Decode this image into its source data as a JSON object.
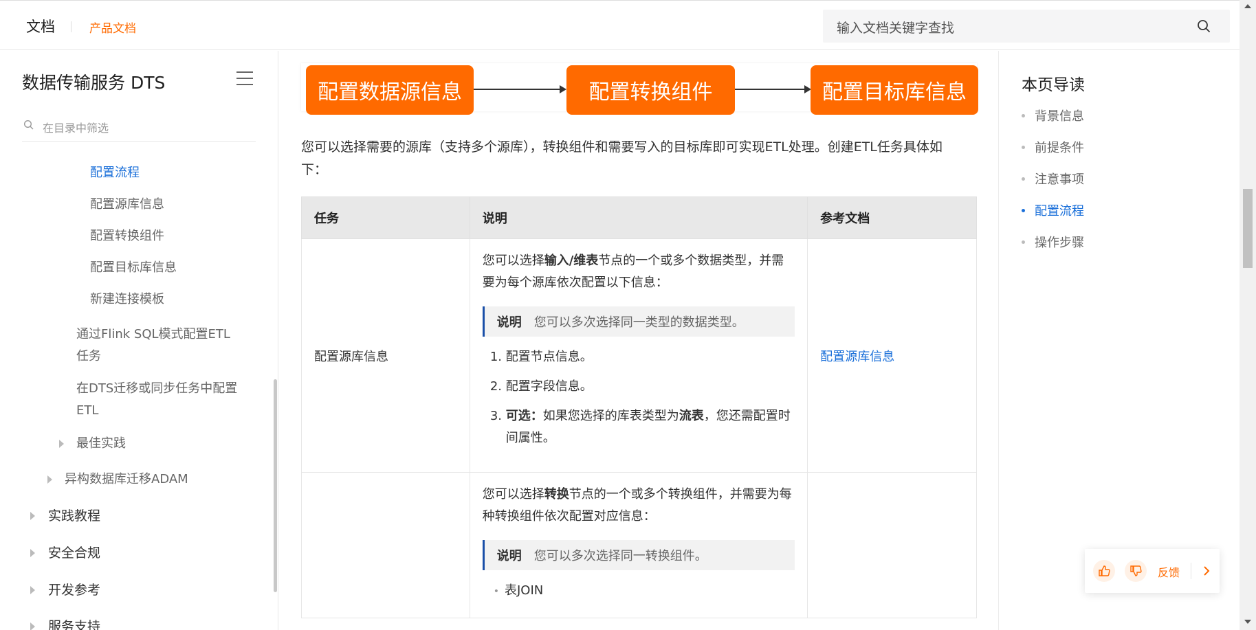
{
  "header": {
    "logo": "文档",
    "product": "产品文档",
    "search_placeholder": "输入文档关键字查找"
  },
  "sidebar": {
    "title": "数据传输服务 DTS",
    "filter_placeholder": "在目录中筛选",
    "items": [
      {
        "label": "配置流程",
        "state": "active"
      },
      {
        "label": "配置源库信息"
      },
      {
        "label": "配置转换组件"
      },
      {
        "label": "配置目标库信息"
      },
      {
        "label": "新建连接模板"
      },
      {
        "label_line1": "通过Flink SQL模式配置ETL",
        "label_line2": "任务"
      },
      {
        "label_line1": "在DTS迁移或同步任务中配置",
        "label_line2": "ETL"
      },
      {
        "label": "最佳实践"
      },
      {
        "label": "异构数据库迁移ADAM"
      },
      {
        "label": "实践教程"
      },
      {
        "label": "安全合规"
      },
      {
        "label": "开发参考"
      },
      {
        "label": "服务支持"
      }
    ]
  },
  "flow": {
    "steps": [
      "配置数据源信息",
      "配置转换组件",
      "配置目标库信息"
    ]
  },
  "intro": {
    "line1": "您可以选择需要的源库（支持多个源库），转换组件和需要写入的目标库即可实现ETL处理。创建ETL任务具体如",
    "line2": "下："
  },
  "table": {
    "headers": [
      "任务",
      "说明",
      "参考文档"
    ],
    "row1": {
      "task": "配置源库信息",
      "desc_pre": "您可以选择",
      "desc_bold": "输入/维表",
      "desc_post": "节点的一个或多个数据类型，并需要为每个源库依次配置以下信息：",
      "note_label": "说明",
      "note_text": "您可以多次选择同一类型的数据类型。",
      "step1": "配置节点信息。",
      "step2": "配置字段信息。",
      "step3_bold": "可选：",
      "step3_pre": "如果您选择的库表类型为",
      "step3_bold2": "流表",
      "step3_post": "，您还需配置时间属性。",
      "ref": "配置源库信息"
    },
    "row2": {
      "desc_pre": "您可以选择",
      "desc_bold": "转换",
      "desc_post": "节点的一个或多个转换组件，并需要为每种转换组件依次配置对应信息：",
      "note_label": "说明",
      "note_text": "您可以多次选择同一转换组件。",
      "bullet1": "表JOIN"
    }
  },
  "right_toc": {
    "title": "本页导读",
    "items": [
      {
        "label": "背景信息"
      },
      {
        "label": "前提条件"
      },
      {
        "label": "注意事项"
      },
      {
        "label": "配置流程",
        "state": "active"
      },
      {
        "label": "操作步骤"
      }
    ]
  },
  "feedback": {
    "label": "反馈"
  },
  "colors": {
    "accent": "#ff6a00",
    "link": "#1a6fd9"
  }
}
